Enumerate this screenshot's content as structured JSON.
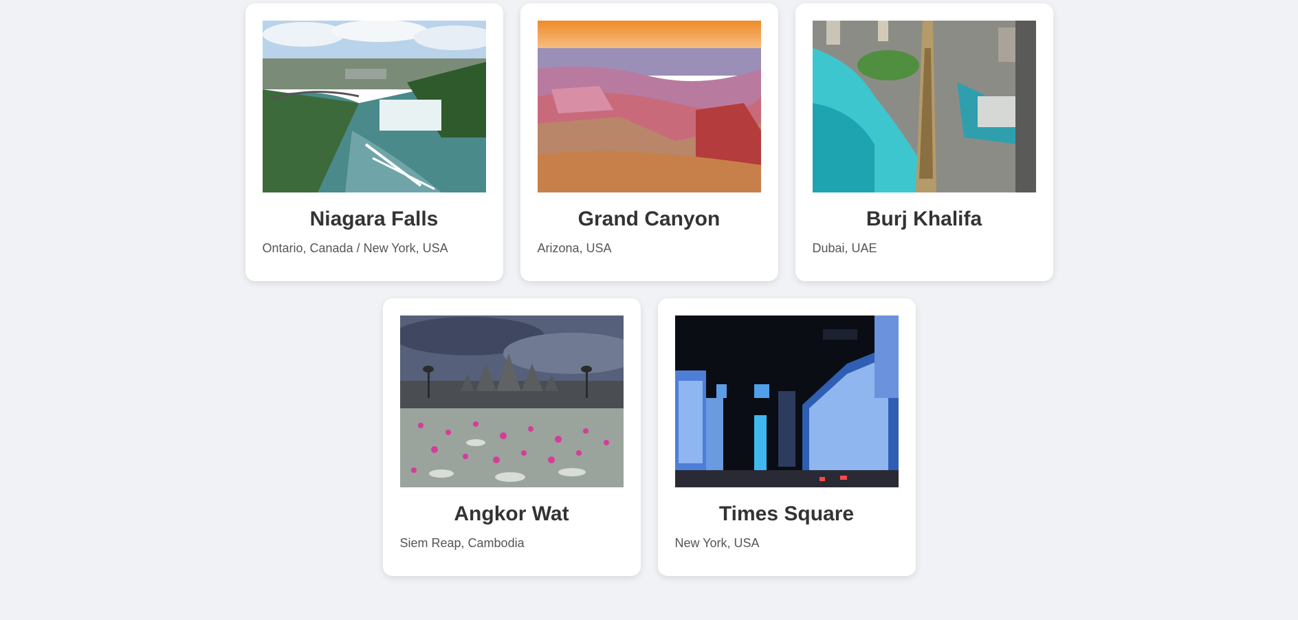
{
  "destinations": [
    {
      "name": "Niagara Falls",
      "location": "Ontario, Canada / New York, USA",
      "image": "waterfall-photo"
    },
    {
      "name": "Grand Canyon",
      "location": "Arizona, USA",
      "image": "canyon-photo"
    },
    {
      "name": "Burj Khalifa",
      "location": "Dubai, UAE",
      "image": "skyscraper-photo"
    },
    {
      "name": "Angkor Wat",
      "location": "Siem Reap, Cambodia",
      "image": "temple-photo"
    },
    {
      "name": "Times Square",
      "location": "New York, USA",
      "image": "city-night-photo"
    }
  ],
  "colors": {
    "page_background": "#f0f2f5",
    "card_background": "#ffffff",
    "title_text": "#333333",
    "location_text": "#555555"
  }
}
